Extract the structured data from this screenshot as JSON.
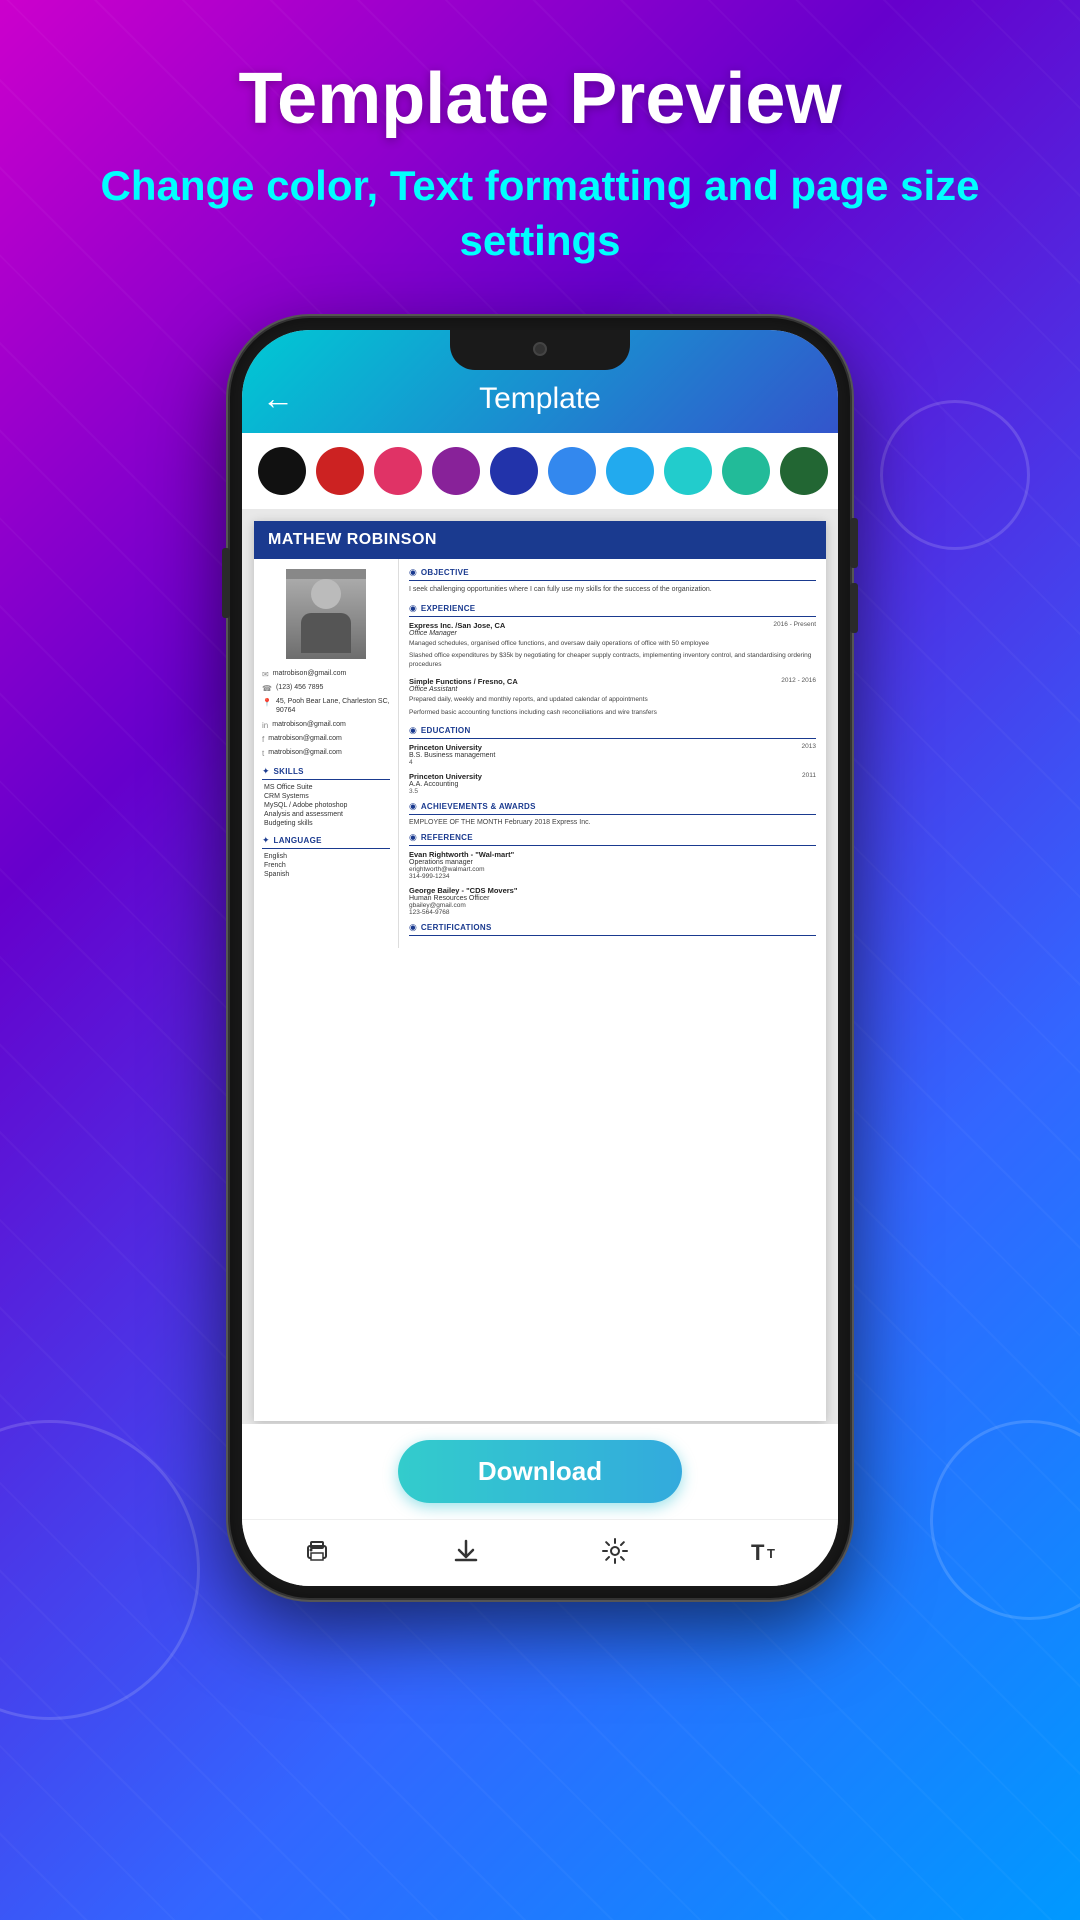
{
  "background": {
    "gradient_start": "#cc00cc",
    "gradient_end": "#0099ff"
  },
  "header": {
    "title": "Template Preview",
    "subtitle": "Change color, Text formatting and page size settings"
  },
  "app": {
    "back_label": "←",
    "screen_title": "Template"
  },
  "color_palette": {
    "colors": [
      {
        "name": "black",
        "hex": "#111111"
      },
      {
        "name": "red",
        "hex": "#cc2222"
      },
      {
        "name": "pink",
        "hex": "#e03366"
      },
      {
        "name": "purple",
        "hex": "#882299"
      },
      {
        "name": "navy",
        "hex": "#2233aa"
      },
      {
        "name": "blue",
        "hex": "#3388ee"
      },
      {
        "name": "light-blue",
        "hex": "#22aaee"
      },
      {
        "name": "cyan",
        "hex": "#22cccc"
      },
      {
        "name": "teal",
        "hex": "#22bb99"
      },
      {
        "name": "green",
        "hex": "#226633"
      }
    ]
  },
  "resume": {
    "name": "MATHEW ROBINSON",
    "photo_alt": "Profile photo",
    "contact": {
      "email": "matrobison@gmail.com",
      "phone": "(123) 456 7895",
      "address": "45, Pooh Bear Lane, Charleston SC, 90764",
      "linkedin": "matrobison@gmail.com",
      "facebook": "matrobison@gmail.com",
      "twitter": "matrobison@gmail.com"
    },
    "skills": {
      "section_title": "SKILLS",
      "items": [
        "MS Office Suite",
        "CRM Systems",
        "MySQL / Adobe photoshop",
        "Analysis and assessment",
        "Budgeting skills"
      ]
    },
    "language": {
      "section_title": "LANGUAGE",
      "items": [
        "English",
        "French",
        "Spanish"
      ]
    },
    "objective": {
      "section_title": "OBJECTIVE",
      "text": "I seek challenging opportunities where I can fully use my skills for the success of the organization."
    },
    "experience": {
      "section_title": "EXPERIENCE",
      "entries": [
        {
          "company": "Express Inc. /San Jose, CA",
          "dates": "2016 - Present",
          "role": "Office Manager",
          "description": "Managed schedules, organised office functions, and oversaw daily operations of office with 50 employee\n\nSlashed office expenditures by $35k by negotiating for cheaper supply contracts, implementing inventory control, and standardising ordering procedures"
        },
        {
          "company": "Simple Functions / Fresno, CA",
          "dates": "2012 - 2016",
          "role": "Office Assistant",
          "description": "Prepared daily, weekly and monthly reports, and updated calendar of appointments\n\nPerformed basic accounting functions including cash reconciliations and wire transfers"
        }
      ]
    },
    "education": {
      "section_title": "EDUCATION",
      "entries": [
        {
          "school": "Princeton University",
          "year": "2013",
          "degree": "B.S. Business management",
          "gpa": "4"
        },
        {
          "school": "Princeton University",
          "year": "2011",
          "degree": "A.A. Accounting",
          "gpa": "3.5"
        }
      ]
    },
    "achievements": {
      "section_title": "ACHIEVEMENTS & AWARDS",
      "text": "EMPLOYEE OF THE MONTH February 2018 Express Inc."
    },
    "reference": {
      "section_title": "REFERENCE",
      "entries": [
        {
          "name": "Evan Rightworth - \"Wal-mart\"",
          "role": "Operations manager",
          "email": "erightworth@walmart.com",
          "phone": "314-999-1234"
        },
        {
          "name": "George Bailey - \"CDS Movers\"",
          "role": "Human Resources Officer",
          "email": "gbailey@gmail.com",
          "phone": "123-564-9768"
        }
      ]
    },
    "certifications": {
      "section_title": "CERTIFICATIONS"
    }
  },
  "download_button": {
    "label": "Download"
  },
  "bottom_nav": {
    "items": [
      {
        "name": "print",
        "icon": "🖨",
        "label": "Print"
      },
      {
        "name": "download-nav",
        "icon": "⬇",
        "label": "Download"
      },
      {
        "name": "settings",
        "icon": "⚙",
        "label": "Settings"
      },
      {
        "name": "text-size",
        "icon": "T",
        "label": "Text Size"
      }
    ]
  }
}
